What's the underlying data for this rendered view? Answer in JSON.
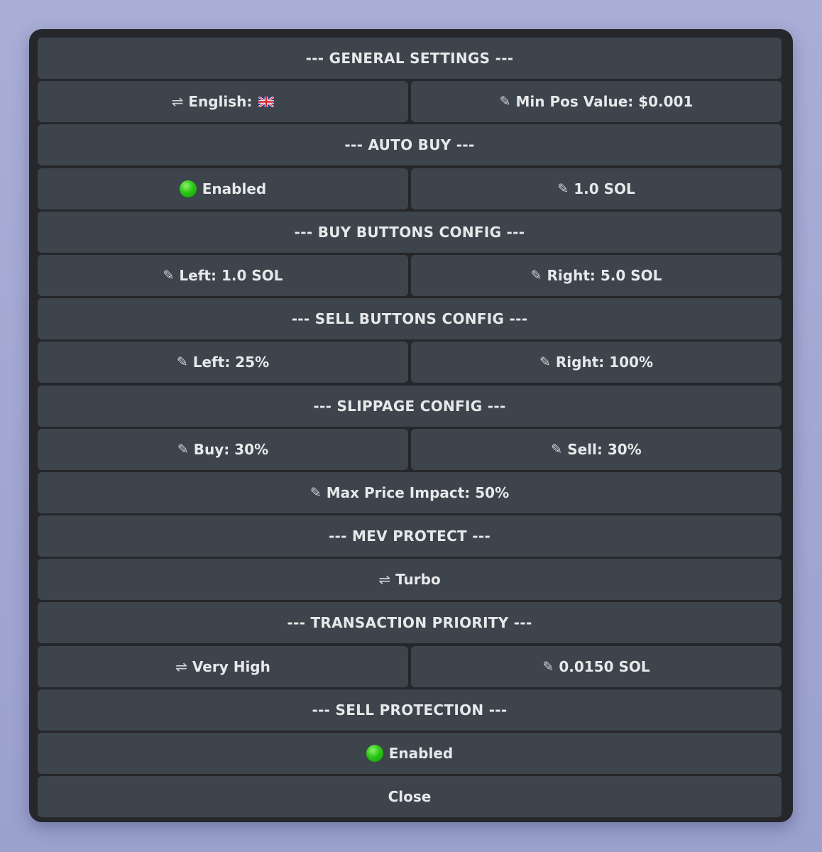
{
  "general": {
    "header": "--- GENERAL SETTINGS ---",
    "language_label": "English:",
    "language_flag": "uk-flag",
    "min_pos_value_label": "Min Pos Value: $0.001"
  },
  "auto_buy": {
    "header": "--- AUTO BUY ---",
    "status_label": "Enabled",
    "amount_label": "1.0 SOL"
  },
  "buy_buttons": {
    "header": "--- BUY BUTTONS CONFIG ---",
    "left_label": "Left: 1.0 SOL",
    "right_label": "Right: 5.0 SOL"
  },
  "sell_buttons": {
    "header": "--- SELL BUTTONS CONFIG ---",
    "left_label": "Left: 25%",
    "right_label": "Right: 100%"
  },
  "slippage": {
    "header": "--- SLIPPAGE CONFIG ---",
    "buy_label": "Buy: 30%",
    "sell_label": "Sell: 30%",
    "max_price_impact_label": "Max Price Impact: 50%"
  },
  "mev": {
    "header": "--- MEV PROTECT ---",
    "mode_label": "Turbo"
  },
  "priority": {
    "header": "--- TRANSACTION PRIORITY ---",
    "level_label": "Very High",
    "fee_label": "0.0150 SOL"
  },
  "sell_protection": {
    "header": "--- SELL PROTECTION ---",
    "status_label": "Enabled"
  },
  "close_label": "Close",
  "icons": {
    "swap": "⇌",
    "pencil": "✎"
  },
  "colors": {
    "page_background": "#a9aed6",
    "panel_background": "#26272b",
    "button_background": "#3d444b",
    "text": "#e6e8ea",
    "status_green": "#2bc617"
  }
}
